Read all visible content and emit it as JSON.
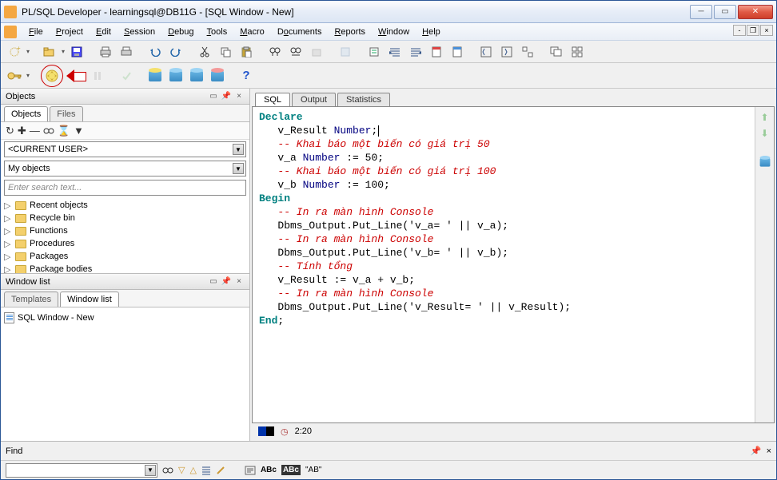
{
  "window": {
    "title": "PL/SQL Developer - learningsql@DB11G - [SQL Window - New]"
  },
  "menu": {
    "file": "File",
    "project": "Project",
    "edit": "Edit",
    "session": "Session",
    "debug": "Debug",
    "tools": "Tools",
    "macro": "Macro",
    "documents": "Documents",
    "reports": "Reports",
    "window": "Window",
    "help": "Help"
  },
  "panels": {
    "objects_title": "Objects",
    "objects_tab": "Objects",
    "files_tab": "Files",
    "current_user": "<CURRENT USER>",
    "my_objects": "My objects",
    "search_placeholder": "Enter search text...",
    "tree": [
      "Recent objects",
      "Recycle bin",
      "Functions",
      "Procedures",
      "Packages",
      "Package bodies"
    ],
    "window_list_title": "Window list",
    "templates_tab": "Templates",
    "window_list_tab": "Window list",
    "window_item": "SQL Window - New"
  },
  "editor": {
    "tabs": {
      "sql": "SQL",
      "output": "Output",
      "statistics": "Statistics"
    },
    "code": {
      "l1": {
        "a": "Declare"
      },
      "l2": {
        "a": "   v_Result ",
        "b": "Number",
        "c": ";"
      },
      "l3": {
        "a": "   -- Khai báo một biến có giá trị 50"
      },
      "l4": {
        "a": "   v_a ",
        "b": "Number",
        "c": " := ",
        "d": "50",
        "e": ";"
      },
      "l5": {
        "a": "   -- Khai báo một biến có giá trị 100"
      },
      "l6": {
        "a": "   v_b ",
        "b": "Number",
        "c": " := ",
        "d": "100",
        "e": ";"
      },
      "l7": {
        "a": "Begin"
      },
      "l8": {
        "a": "   -- In ra màn hình Console"
      },
      "l9": {
        "a": "   Dbms_Output.Put_Line(",
        "b": "'v_a= '",
        "c": " || v_a);"
      },
      "l10": {
        "a": "   -- In ra màn hình Console"
      },
      "l11": {
        "a": "   Dbms_Output.Put_Line(",
        "b": "'v_b= '",
        "c": " || v_b);"
      },
      "l12": {
        "a": "   -- Tính tổng"
      },
      "l13": {
        "a": "   v_Result := v_a + v_b;"
      },
      "l14": {
        "a": "   -- In ra màn hình Console"
      },
      "l15": {
        "a": "   Dbms_Output.Put_Line(",
        "b": "'v_Result= '",
        "c": " || v_Result);"
      },
      "l16": {
        "a": "End",
        "b": ";"
      }
    },
    "status_pos": "2:20"
  },
  "find": {
    "label": "Find",
    "ab_label": "\"AB\""
  }
}
